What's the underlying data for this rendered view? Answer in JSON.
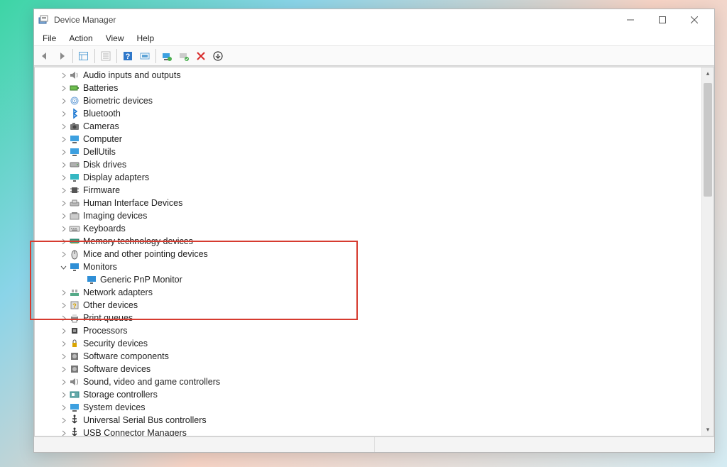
{
  "window": {
    "title": "Device Manager"
  },
  "menus": {
    "file": "File",
    "action": "Action",
    "view": "View",
    "help": "Help"
  },
  "tree": {
    "items": [
      {
        "label": "Audio inputs and outputs",
        "icon": "speaker"
      },
      {
        "label": "Batteries",
        "icon": "battery"
      },
      {
        "label": "Biometric devices",
        "icon": "fingerprint"
      },
      {
        "label": "Bluetooth",
        "icon": "bluetooth"
      },
      {
        "label": "Cameras",
        "icon": "camera"
      },
      {
        "label": "Computer",
        "icon": "computer"
      },
      {
        "label": "DellUtils",
        "icon": "computer"
      },
      {
        "label": "Disk drives",
        "icon": "disk"
      },
      {
        "label": "Display adapters",
        "icon": "display"
      },
      {
        "label": "Firmware",
        "icon": "chip"
      },
      {
        "label": "Human Interface Devices",
        "icon": "hid"
      },
      {
        "label": "Imaging devices",
        "icon": "imaging"
      },
      {
        "label": "Keyboards",
        "icon": "keyboard"
      },
      {
        "label": "Memory technology devices",
        "icon": "memory"
      },
      {
        "label": "Mice and other pointing devices",
        "icon": "mouse"
      },
      {
        "label": "Monitors",
        "icon": "monitor",
        "expanded": true,
        "children": [
          {
            "label": "Generic PnP Monitor",
            "icon": "monitor"
          }
        ]
      },
      {
        "label": "Network adapters",
        "icon": "network"
      },
      {
        "label": "Other devices",
        "icon": "other"
      },
      {
        "label": "Print queues",
        "icon": "printer"
      },
      {
        "label": "Processors",
        "icon": "cpu"
      },
      {
        "label": "Security devices",
        "icon": "security"
      },
      {
        "label": "Software components",
        "icon": "software"
      },
      {
        "label": "Software devices",
        "icon": "software"
      },
      {
        "label": "Sound, video and game controllers",
        "icon": "sound"
      },
      {
        "label": "Storage controllers",
        "icon": "storage"
      },
      {
        "label": "System devices",
        "icon": "system"
      },
      {
        "label": "Universal Serial Bus controllers",
        "icon": "usb"
      },
      {
        "label": "USB Connector Managers",
        "icon": "usb"
      }
    ]
  }
}
